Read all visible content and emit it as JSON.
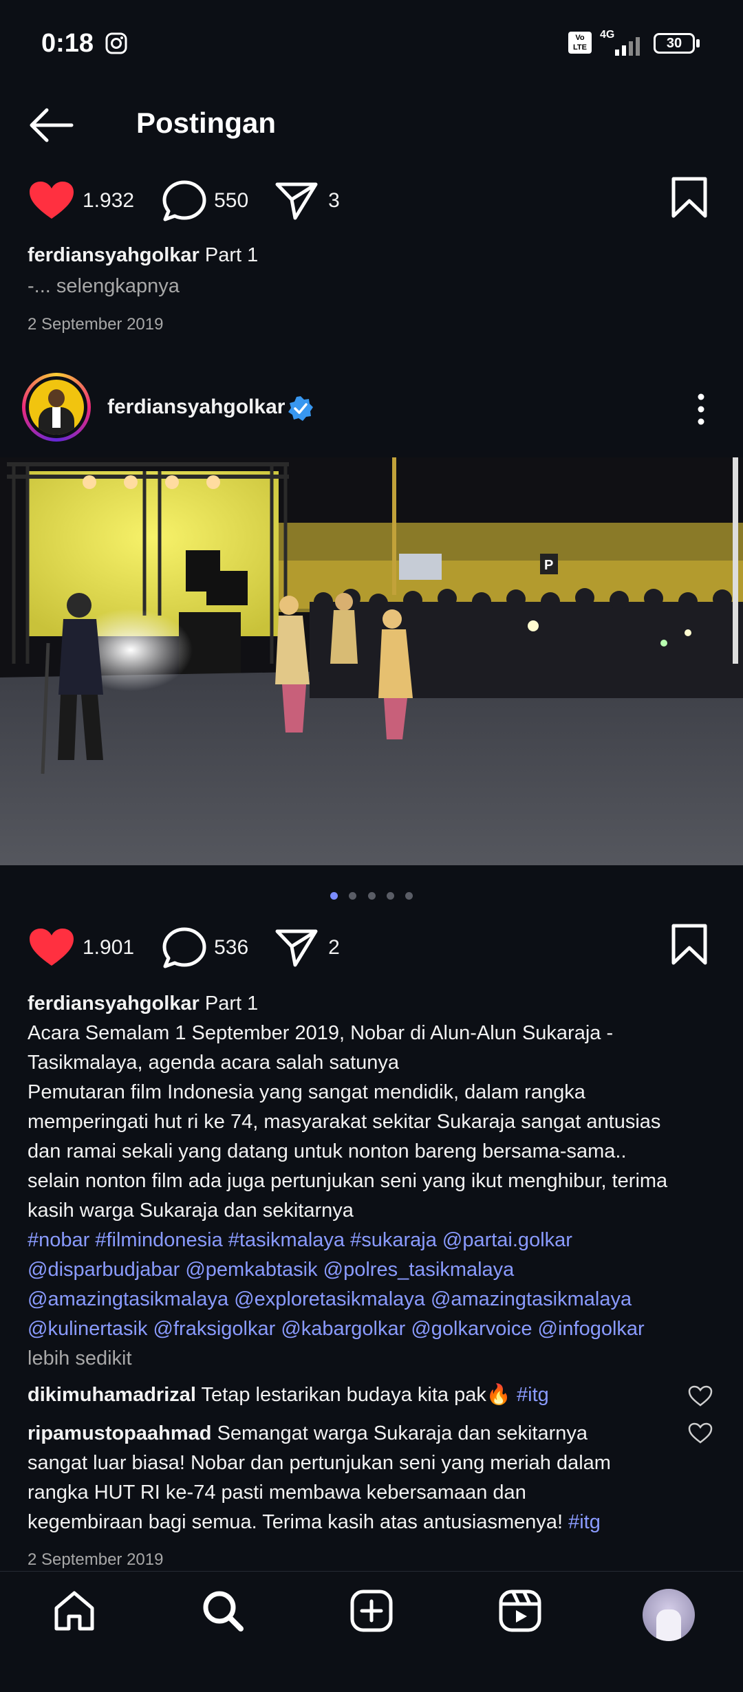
{
  "status_bar": {
    "time": "0:18",
    "network": "4G",
    "volte": "Vo LTE",
    "battery": "30"
  },
  "header": {
    "title": "Postingan"
  },
  "top_post": {
    "likes": "1.932",
    "comments": "550",
    "shares": "3",
    "username": "ferdiansyahgolkar",
    "caption": "Part 1",
    "more": "-... selengkapnya",
    "date": "2 September 2019"
  },
  "post": {
    "username": "ferdiansyahgolkar",
    "verified": true,
    "carousel_count": 5,
    "carousel_active": 0,
    "likes": "1.901",
    "comments": "536",
    "shares": "2",
    "caption_title": "Part 1",
    "caption_lines": [
      "Acara Semalam 1 September 2019, Nobar di Alun-Alun Sukaraja -",
      "Tasikmalaya, agenda acara salah satunya",
      "Pemutaran film Indonesia yang sangat mendidik,  dalam rangka",
      "memperingati hut ri ke 74, masyarakat sekitar Sukaraja sangat antusias",
      "dan ramai sekali yang datang untuk nonton bareng bersama-sama..",
      "selain nonton film ada juga pertunjukan seni yang ikut menghibur, terima",
      "kasih warga Sukaraja dan sekitarnya"
    ],
    "hashtag_lines": [
      "#nobar #filmindonesia #tasikmalaya #sukaraja @partai.golkar",
      "@disparbudjabar @pemkabtasik @polres_tasikmalaya",
      "@amazingtasikmalaya @exploretasikmalaya @amazingtasikmalaya",
      "@kulinertasik @fraksigolkar @kabargolkar @golkarvoice @infogolkar"
    ],
    "less": "lebih sedikit",
    "comments_list": [
      {
        "user": "dikimuhamadrizal",
        "text": "Tetap lestarikan budaya kita pak🔥",
        "tag": "#itg"
      },
      {
        "user": "ripamustopaahmad",
        "lines": [
          "Semangat warga Sukaraja dan sekitarnya",
          "sangat luar biasa! Nobar dan pertunjukan seni yang meriah dalam",
          "rangka HUT RI ke-74 pasti membawa kebersamaan dan",
          "kegembiraan bagi semua. Terima kasih atas antusiasmenya!"
        ],
        "tag": "#itg"
      }
    ],
    "date": "2 September 2019"
  },
  "colors": {
    "background": "#0c0f15",
    "like_red": "#ff3040",
    "link_blue": "#8a9bff",
    "verified_blue": "#3897f0"
  },
  "bottom_nav": {
    "items": [
      "home-icon",
      "search-icon",
      "create-icon",
      "reels-icon",
      "profile-avatar"
    ]
  }
}
